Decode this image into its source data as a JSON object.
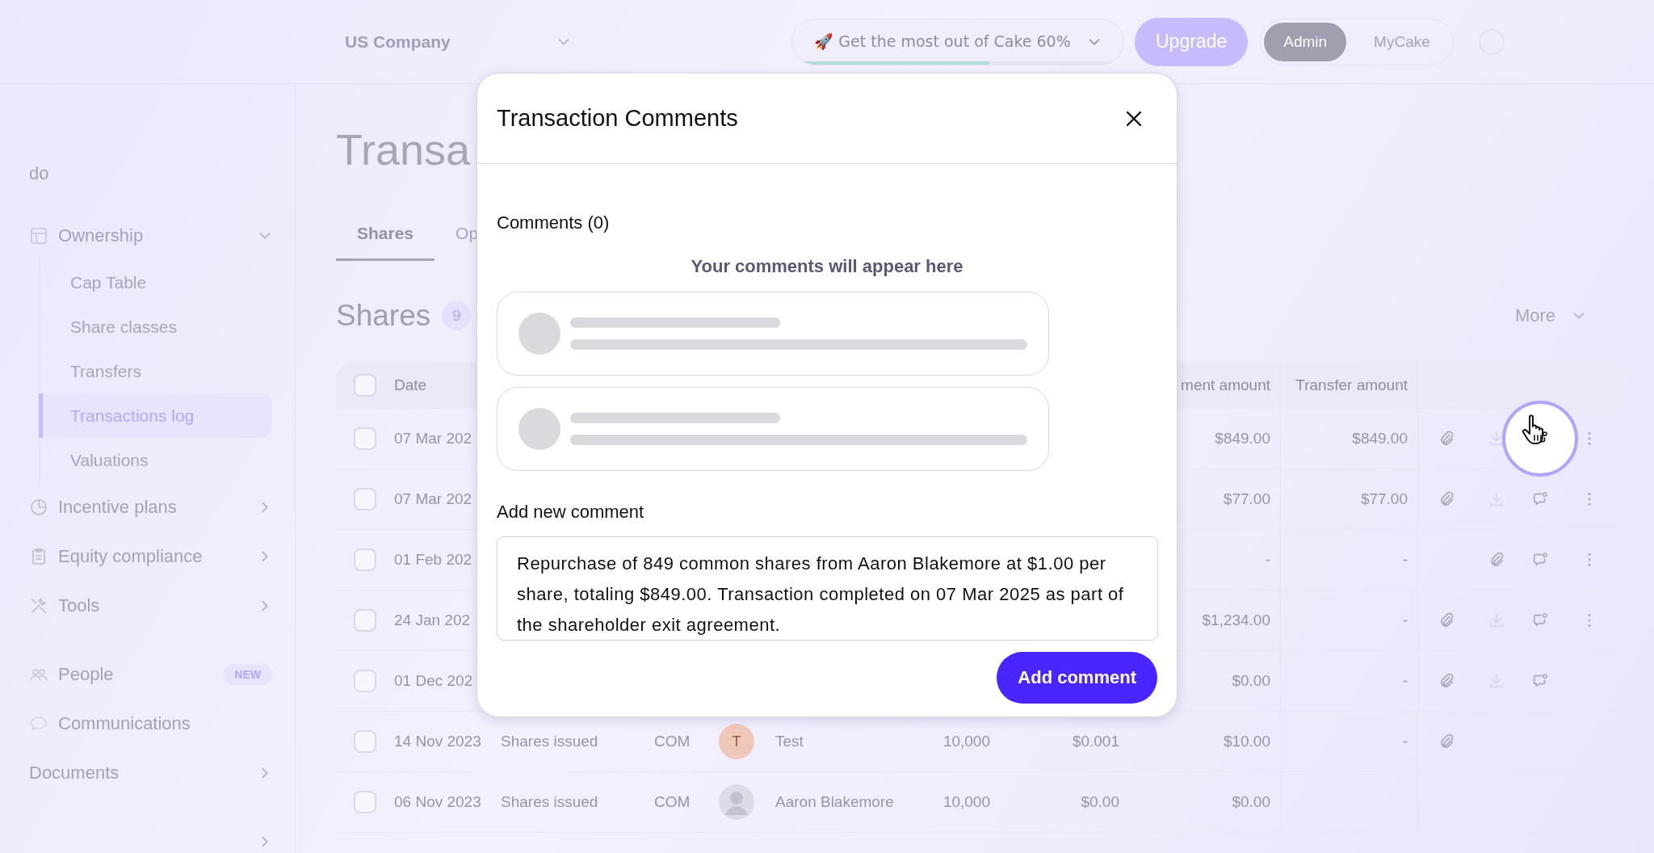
{
  "topbar": {
    "company": "US Company",
    "promo": {
      "label": "🚀 Get the most out of Cake 60%",
      "level": 0.6
    },
    "upgrade": "Upgrade",
    "modes": [
      {
        "label": "Admin",
        "selected": true
      },
      {
        "label": "MyCake",
        "selected": false
      }
    ]
  },
  "sidebar": {
    "items": [
      {
        "kind": "link",
        "label": "do"
      },
      {
        "kind": "group",
        "label": "Ownership",
        "expanded": true,
        "children": [
          {
            "label": "Cap Table",
            "selected": false
          },
          {
            "label": "Share classes",
            "selected": false
          },
          {
            "label": "Transfers",
            "selected": false
          },
          {
            "label": "Transactions log",
            "selected": true
          },
          {
            "label": "Valuations",
            "selected": false
          }
        ]
      },
      {
        "kind": "group",
        "label": "Incentive plans",
        "expanded": false
      },
      {
        "kind": "group",
        "label": "Equity compliance",
        "expanded": false
      },
      {
        "kind": "group",
        "label": "Tools",
        "expanded": false
      },
      {
        "kind": "spacer"
      },
      {
        "kind": "link",
        "label": "People",
        "badge": "NEW"
      },
      {
        "kind": "link",
        "label": "Communications"
      },
      {
        "kind": "group",
        "label": "Documents",
        "expanded": false
      },
      {
        "kind": "spacer"
      },
      {
        "kind": "group",
        "expanded": false
      }
    ]
  },
  "page": {
    "title": "Transa",
    "tabs": [
      {
        "label": "Shares",
        "selected": true
      },
      {
        "label": "Op",
        "selected": false
      }
    ],
    "section": "Shares",
    "count": "9",
    "more": "More"
  },
  "table": {
    "header": {
      "all_selected": false,
      "date": "Date",
      "amount": "ment amount",
      "transfer": "Transfer amount"
    },
    "rows": [
      {
        "selected": false,
        "date": "07 Mar 202",
        "amount": "$849.00",
        "transfer": "$849.00",
        "actions": [
          {
            "kind": "attach"
          },
          {
            "kind": "download"
          },
          {
            "kind": "comment",
            "highlighted": true
          },
          {
            "kind": "more"
          }
        ]
      },
      {
        "selected": false,
        "date": "07 Mar 202",
        "amount": "$77.00",
        "transfer": "$77.00",
        "actions": [
          {
            "kind": "attach"
          },
          {
            "kind": "download"
          },
          {
            "kind": "comment",
            "highlighted": false
          },
          {
            "kind": "more"
          }
        ]
      },
      {
        "selected": false,
        "date": "01 Feb 202",
        "amount": "-",
        "transfer": "-",
        "actions": [
          {
            "kind": "none"
          },
          {
            "kind": "attach"
          },
          {
            "kind": "comment",
            "highlighted": false
          },
          {
            "kind": "more"
          }
        ]
      },
      {
        "selected": false,
        "date": "24 Jan 202",
        "amount": "$1,234.00",
        "transfer": "-",
        "actions": [
          {
            "kind": "attach"
          },
          {
            "kind": "download"
          },
          {
            "kind": "comment",
            "highlighted": false
          },
          {
            "kind": "more"
          }
        ]
      },
      {
        "selected": false,
        "date": "01 Dec 202",
        "amount": "$0.00",
        "transfer": "-",
        "actions": [
          {
            "kind": "attach"
          },
          {
            "kind": "download"
          },
          {
            "kind": "comment",
            "highlighted": false
          }
        ]
      },
      {
        "selected": false,
        "date": "14 Nov 2023",
        "type": "Shares issued",
        "class": "COM",
        "avatar": {
          "kind": "initial",
          "text": "T"
        },
        "name": "Test",
        "quantity": "10,000",
        "price": "$0.001",
        "amount": "$10.00",
        "transfer": "-",
        "actions": [
          {
            "kind": "attach"
          }
        ]
      },
      {
        "selected": false,
        "date": "06 Nov 2023",
        "type": "Shares issued",
        "class": "COM",
        "avatar": {
          "kind": "photo"
        },
        "name": "Aaron Blakemore",
        "quantity": "10,000",
        "price": "$0.00",
        "amount": "$0.00"
      }
    ]
  },
  "modal": {
    "title": "Transaction Comments",
    "comments_heading": "Comments (0)",
    "empty_text": "Your comments will appear here",
    "placeholders": [
      {
        "kind": "skeleton"
      },
      {
        "kind": "skeleton"
      }
    ],
    "new_label": "Add new comment",
    "value": "Repurchase of 849 common shares from Aaron Blakemore at $1.00 per share, totaling $849.00. Transaction completed on 07 Mar 2025 as part of the shareholder exit agreement.",
    "submit": "Add comment"
  }
}
